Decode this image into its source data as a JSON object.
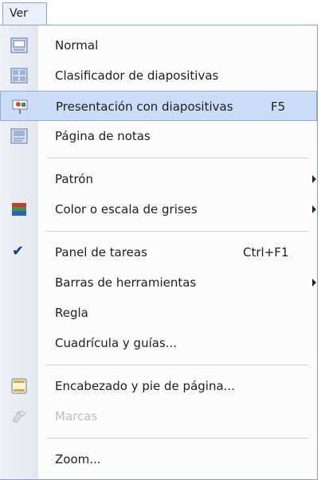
{
  "menubar": {
    "label": "Ver"
  },
  "menu": {
    "items": [
      {
        "label": "Normal",
        "icon": "normal-view-icon"
      },
      {
        "label": "Clasificador de diapositivas",
        "icon": "slide-sorter-icon"
      },
      {
        "label": "Presentación con diapositivas",
        "shortcut": "F5",
        "icon": "slideshow-icon",
        "highlighted": true
      },
      {
        "label": "Página de notas",
        "icon": "notes-page-icon"
      },
      {
        "label": "Patrón",
        "submenu": true
      },
      {
        "label": "Color o escala de grises",
        "icon": "color-grayscale-icon",
        "submenu": true
      },
      {
        "label": "Panel de tareas",
        "shortcut": "Ctrl+F1",
        "checked": true
      },
      {
        "label": "Barras de herramientas",
        "submenu": true
      },
      {
        "label": "Regla"
      },
      {
        "label": "Cuadrícula y guías..."
      },
      {
        "label": "Encabezado y pie de página...",
        "icon": "header-footer-icon"
      },
      {
        "label": "Marcas",
        "icon": "markup-icon",
        "disabled": true
      },
      {
        "label": "Zoom..."
      }
    ]
  },
  "colors": {
    "highlight": "#cbdcf6",
    "highlight_border": "#93add7",
    "disabled_text": "#b8bcc4"
  }
}
